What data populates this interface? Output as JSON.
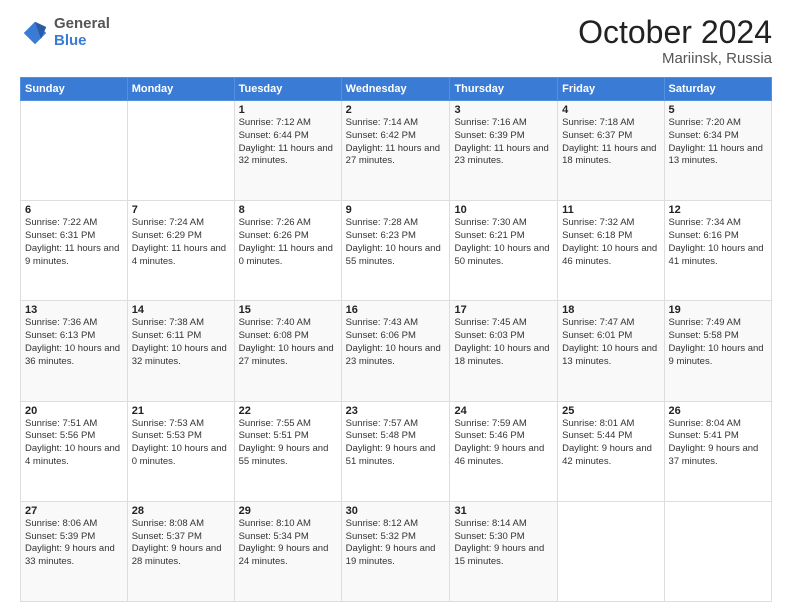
{
  "header": {
    "logo": {
      "general": "General",
      "blue": "Blue"
    },
    "title": "October 2024",
    "location": "Mariinsk, Russia"
  },
  "days_of_week": [
    "Sunday",
    "Monday",
    "Tuesday",
    "Wednesday",
    "Thursday",
    "Friday",
    "Saturday"
  ],
  "weeks": [
    [
      {
        "num": "",
        "sunrise": "",
        "sunset": "",
        "daylight": ""
      },
      {
        "num": "",
        "sunrise": "",
        "sunset": "",
        "daylight": ""
      },
      {
        "num": "1",
        "sunrise": "Sunrise: 7:12 AM",
        "sunset": "Sunset: 6:44 PM",
        "daylight": "Daylight: 11 hours and 32 minutes."
      },
      {
        "num": "2",
        "sunrise": "Sunrise: 7:14 AM",
        "sunset": "Sunset: 6:42 PM",
        "daylight": "Daylight: 11 hours and 27 minutes."
      },
      {
        "num": "3",
        "sunrise": "Sunrise: 7:16 AM",
        "sunset": "Sunset: 6:39 PM",
        "daylight": "Daylight: 11 hours and 23 minutes."
      },
      {
        "num": "4",
        "sunrise": "Sunrise: 7:18 AM",
        "sunset": "Sunset: 6:37 PM",
        "daylight": "Daylight: 11 hours and 18 minutes."
      },
      {
        "num": "5",
        "sunrise": "Sunrise: 7:20 AM",
        "sunset": "Sunset: 6:34 PM",
        "daylight": "Daylight: 11 hours and 13 minutes."
      }
    ],
    [
      {
        "num": "6",
        "sunrise": "Sunrise: 7:22 AM",
        "sunset": "Sunset: 6:31 PM",
        "daylight": "Daylight: 11 hours and 9 minutes."
      },
      {
        "num": "7",
        "sunrise": "Sunrise: 7:24 AM",
        "sunset": "Sunset: 6:29 PM",
        "daylight": "Daylight: 11 hours and 4 minutes."
      },
      {
        "num": "8",
        "sunrise": "Sunrise: 7:26 AM",
        "sunset": "Sunset: 6:26 PM",
        "daylight": "Daylight: 11 hours and 0 minutes."
      },
      {
        "num": "9",
        "sunrise": "Sunrise: 7:28 AM",
        "sunset": "Sunset: 6:23 PM",
        "daylight": "Daylight: 10 hours and 55 minutes."
      },
      {
        "num": "10",
        "sunrise": "Sunrise: 7:30 AM",
        "sunset": "Sunset: 6:21 PM",
        "daylight": "Daylight: 10 hours and 50 minutes."
      },
      {
        "num": "11",
        "sunrise": "Sunrise: 7:32 AM",
        "sunset": "Sunset: 6:18 PM",
        "daylight": "Daylight: 10 hours and 46 minutes."
      },
      {
        "num": "12",
        "sunrise": "Sunrise: 7:34 AM",
        "sunset": "Sunset: 6:16 PM",
        "daylight": "Daylight: 10 hours and 41 minutes."
      }
    ],
    [
      {
        "num": "13",
        "sunrise": "Sunrise: 7:36 AM",
        "sunset": "Sunset: 6:13 PM",
        "daylight": "Daylight: 10 hours and 36 minutes."
      },
      {
        "num": "14",
        "sunrise": "Sunrise: 7:38 AM",
        "sunset": "Sunset: 6:11 PM",
        "daylight": "Daylight: 10 hours and 32 minutes."
      },
      {
        "num": "15",
        "sunrise": "Sunrise: 7:40 AM",
        "sunset": "Sunset: 6:08 PM",
        "daylight": "Daylight: 10 hours and 27 minutes."
      },
      {
        "num": "16",
        "sunrise": "Sunrise: 7:43 AM",
        "sunset": "Sunset: 6:06 PM",
        "daylight": "Daylight: 10 hours and 23 minutes."
      },
      {
        "num": "17",
        "sunrise": "Sunrise: 7:45 AM",
        "sunset": "Sunset: 6:03 PM",
        "daylight": "Daylight: 10 hours and 18 minutes."
      },
      {
        "num": "18",
        "sunrise": "Sunrise: 7:47 AM",
        "sunset": "Sunset: 6:01 PM",
        "daylight": "Daylight: 10 hours and 13 minutes."
      },
      {
        "num": "19",
        "sunrise": "Sunrise: 7:49 AM",
        "sunset": "Sunset: 5:58 PM",
        "daylight": "Daylight: 10 hours and 9 minutes."
      }
    ],
    [
      {
        "num": "20",
        "sunrise": "Sunrise: 7:51 AM",
        "sunset": "Sunset: 5:56 PM",
        "daylight": "Daylight: 10 hours and 4 minutes."
      },
      {
        "num": "21",
        "sunrise": "Sunrise: 7:53 AM",
        "sunset": "Sunset: 5:53 PM",
        "daylight": "Daylight: 10 hours and 0 minutes."
      },
      {
        "num": "22",
        "sunrise": "Sunrise: 7:55 AM",
        "sunset": "Sunset: 5:51 PM",
        "daylight": "Daylight: 9 hours and 55 minutes."
      },
      {
        "num": "23",
        "sunrise": "Sunrise: 7:57 AM",
        "sunset": "Sunset: 5:48 PM",
        "daylight": "Daylight: 9 hours and 51 minutes."
      },
      {
        "num": "24",
        "sunrise": "Sunrise: 7:59 AM",
        "sunset": "Sunset: 5:46 PM",
        "daylight": "Daylight: 9 hours and 46 minutes."
      },
      {
        "num": "25",
        "sunrise": "Sunrise: 8:01 AM",
        "sunset": "Sunset: 5:44 PM",
        "daylight": "Daylight: 9 hours and 42 minutes."
      },
      {
        "num": "26",
        "sunrise": "Sunrise: 8:04 AM",
        "sunset": "Sunset: 5:41 PM",
        "daylight": "Daylight: 9 hours and 37 minutes."
      }
    ],
    [
      {
        "num": "27",
        "sunrise": "Sunrise: 8:06 AM",
        "sunset": "Sunset: 5:39 PM",
        "daylight": "Daylight: 9 hours and 33 minutes."
      },
      {
        "num": "28",
        "sunrise": "Sunrise: 8:08 AM",
        "sunset": "Sunset: 5:37 PM",
        "daylight": "Daylight: 9 hours and 28 minutes."
      },
      {
        "num": "29",
        "sunrise": "Sunrise: 8:10 AM",
        "sunset": "Sunset: 5:34 PM",
        "daylight": "Daylight: 9 hours and 24 minutes."
      },
      {
        "num": "30",
        "sunrise": "Sunrise: 8:12 AM",
        "sunset": "Sunset: 5:32 PM",
        "daylight": "Daylight: 9 hours and 19 minutes."
      },
      {
        "num": "31",
        "sunrise": "Sunrise: 8:14 AM",
        "sunset": "Sunset: 5:30 PM",
        "daylight": "Daylight: 9 hours and 15 minutes."
      },
      {
        "num": "",
        "sunrise": "",
        "sunset": "",
        "daylight": ""
      },
      {
        "num": "",
        "sunrise": "",
        "sunset": "",
        "daylight": ""
      }
    ]
  ]
}
